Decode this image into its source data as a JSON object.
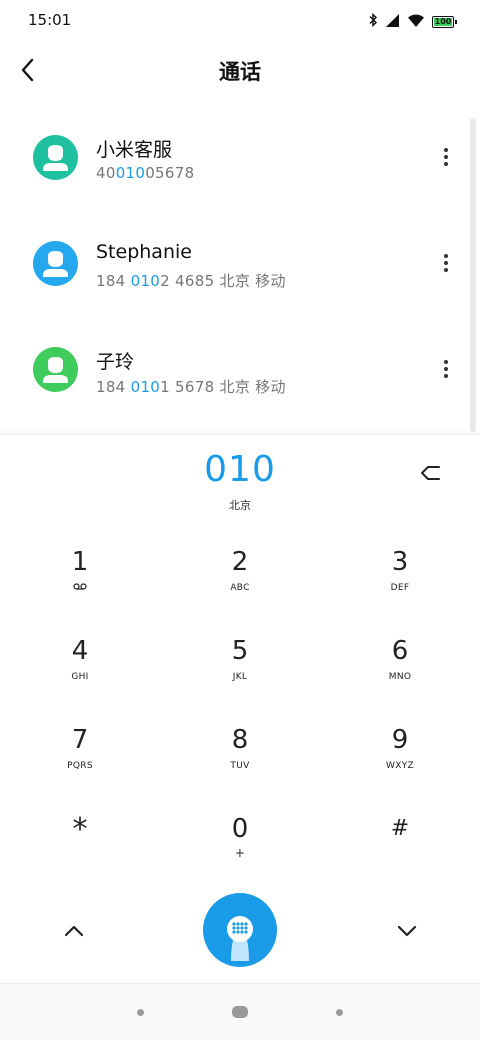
{
  "status_bar": {
    "time": "15:01",
    "battery": "100",
    "icons": [
      "bluetooth-icon",
      "signal-icon",
      "wifi-icon",
      "battery-icon"
    ]
  },
  "header": {
    "title": "通话",
    "back_icon": "chevron-left-icon"
  },
  "contacts": [
    {
      "name": "小米客服",
      "number_parts": [
        "40",
        "010",
        "05678"
      ],
      "location": "",
      "avatar_color": "#1ec0a0"
    },
    {
      "name": "Stephanie",
      "number_parts": [
        "184 ",
        "010",
        "2 4685"
      ],
      "location": "北京 移动",
      "avatar_color": "#26a8ef"
    },
    {
      "name": "子玲",
      "number_parts": [
        "184 ",
        "010",
        "1 5678"
      ],
      "location": "北京 移动",
      "avatar_color": "#3fcc5c"
    }
  ],
  "dialpad": {
    "number": "010",
    "location": "北京",
    "keys": [
      {
        "digit": "1",
        "letters": ""
      },
      {
        "digit": "2",
        "letters": "ABC"
      },
      {
        "digit": "3",
        "letters": "DEF"
      },
      {
        "digit": "4",
        "letters": "GHI"
      },
      {
        "digit": "5",
        "letters": "JKL"
      },
      {
        "digit": "6",
        "letters": "MNO"
      },
      {
        "digit": "7",
        "letters": "PQRS"
      },
      {
        "digit": "8",
        "letters": "TUV"
      },
      {
        "digit": "9",
        "letters": "WXYZ"
      },
      {
        "digit": "*",
        "letters": ""
      },
      {
        "digit": "0",
        "letters": "+"
      },
      {
        "digit": "#",
        "letters": ""
      }
    ]
  },
  "colors": {
    "accent": "#1a9be8",
    "text_secondary": "#777777"
  }
}
